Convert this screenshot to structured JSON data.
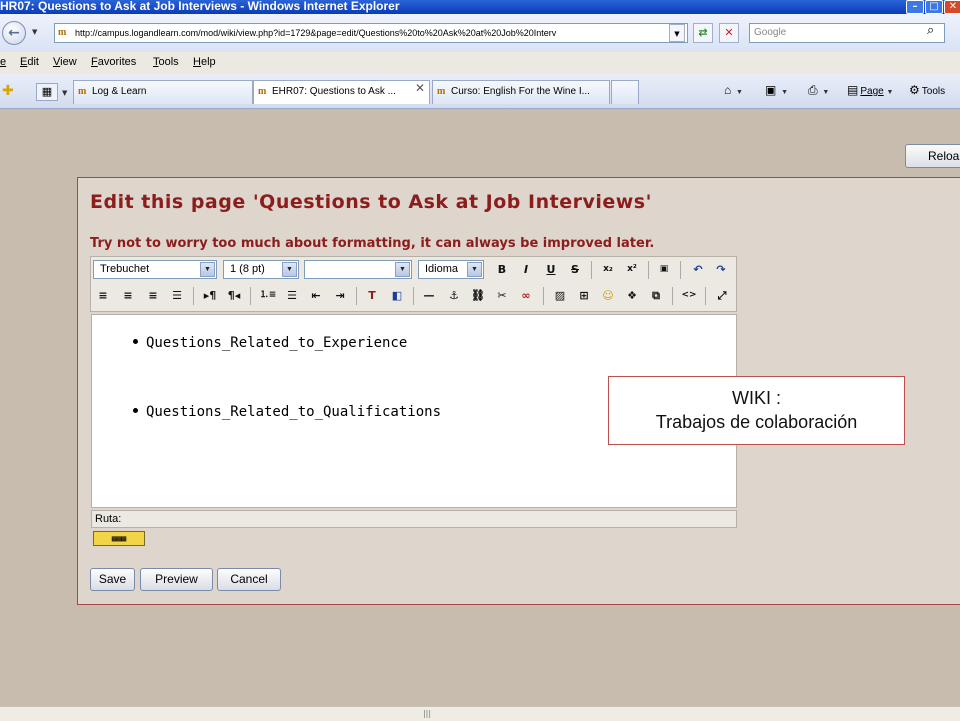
{
  "window": {
    "title": "HR07: Questions to Ask at Job Interviews - Windows Internet Explorer",
    "controls": [
      "–",
      "□",
      "✕"
    ]
  },
  "address_bar": {
    "url": "http://campus.logandlearn.com/mod/wiki/view.php?id=1729&page=edit/Questions%20to%20Ask%20at%20Job%20Interv",
    "search_placeholder": "Google"
  },
  "menu": [
    "e",
    "Edit",
    "View",
    "Favorites",
    "Tools",
    "Help"
  ],
  "tabs": [
    {
      "label": "Log & Learn",
      "active": false
    },
    {
      "label": "EHR07: Questions to Ask ...",
      "active": true
    },
    {
      "label": "Curso: English For the Wine I...",
      "active": false
    }
  ],
  "commands": {
    "page_label": "Page",
    "tools_label": "Tools"
  },
  "reload_label": "Reloa",
  "editor_page": {
    "heading": "Edit this page 'Questions to Ask at Job Interviews'",
    "hint": "Try not to worry too much about formatting, it can always be improved later.",
    "font_family": "Trebuchet",
    "font_size": "1 (8 pt)",
    "format_select": "",
    "language_select": "Idioma",
    "items": [
      "Questions_Related_to_Experience",
      "Questions_Related_to_Qualifications"
    ],
    "path_label": "Ruta:",
    "buttons": {
      "save": "Save",
      "preview": "Preview",
      "cancel": "Cancel"
    }
  },
  "callout": {
    "line1": "WIKI :",
    "line2": "Trabajos de colaboración"
  },
  "colors": {
    "heading": "#8b1d1d",
    "page_background": "#c8bcae",
    "panel_background": "#ded5cd",
    "callout_border": "#c0504d"
  }
}
